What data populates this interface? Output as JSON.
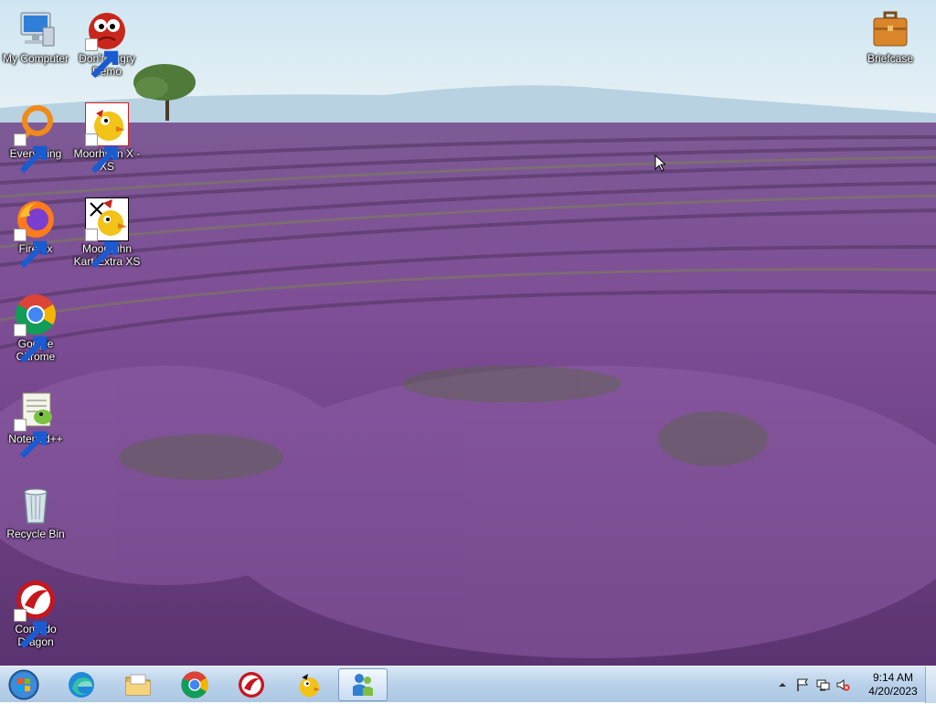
{
  "desktop": {
    "icons": [
      {
        "label": "My Computer",
        "icon": "computer-icon"
      },
      {
        "label": "Don't Angry Demo",
        "icon": "angry-face-icon",
        "shortcut": true
      },
      {
        "label": "Everything",
        "icon": "search-ring-icon",
        "shortcut": true
      },
      {
        "label": "Moorhuhn X - XS",
        "icon": "chicken-icon",
        "shortcut": true
      },
      {
        "label": "Firefox",
        "icon": "firefox-icon",
        "shortcut": true
      },
      {
        "label": "Moorhuhn Kart Extra XS",
        "icon": "chicken-kart-icon",
        "shortcut": true
      },
      {
        "label": "Google Chrome",
        "icon": "chrome-icon",
        "shortcut": true
      },
      {
        "label": "Notepad++",
        "icon": "notepad-plus-icon",
        "shortcut": true
      },
      {
        "label": "Recycle Bin",
        "icon": "recycle-bin-icon"
      },
      {
        "label": "Comodo Dragon",
        "icon": "comodo-dragon-icon",
        "shortcut": true
      },
      {
        "label": "Briefcase",
        "icon": "briefcase-icon"
      }
    ]
  },
  "taskbar": {
    "pinned": [
      {
        "name": "start-button",
        "icon": "windows-orb-icon"
      },
      {
        "name": "edge",
        "icon": "edge-icon"
      },
      {
        "name": "explorer",
        "icon": "folder-icon"
      },
      {
        "name": "chrome",
        "icon": "chrome-icon"
      },
      {
        "name": "comodo-dragon",
        "icon": "comodo-dragon-icon"
      },
      {
        "name": "moorhuhn",
        "icon": "chicken-icon"
      },
      {
        "name": "active-app",
        "icon": "people-icon",
        "active": true
      }
    ],
    "tray": {
      "icons": [
        "show-hidden-icon",
        "flag-icon",
        "network-icon",
        "volume-muted-icon"
      ],
      "time": "9:14 AM",
      "date": "4/20/2023"
    }
  },
  "colors": {
    "lavender": "#7a4f93",
    "sky": "#d9ecf4",
    "taskbar": "#b9d1ea"
  }
}
